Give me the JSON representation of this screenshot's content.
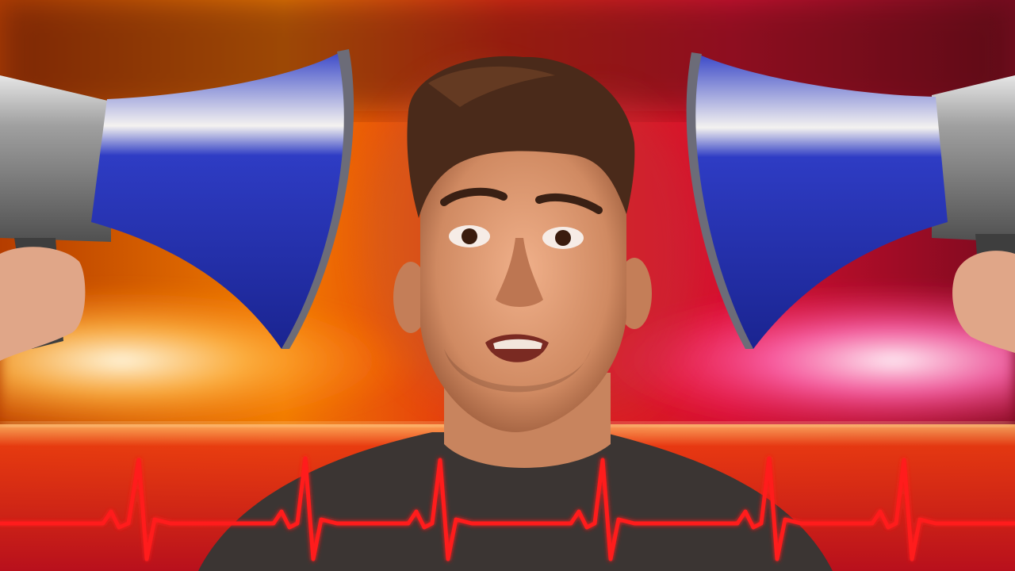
{
  "scene": {
    "subject": "worried-man",
    "props": [
      "megaphone-left",
      "megaphone-right",
      "hand-left",
      "hand-right",
      "heartbeat-line"
    ],
    "colors": {
      "left_glow": "#ff8a00",
      "center_red": "#e3122a",
      "right_glow": "#ff2a6a",
      "megaphone_blue": "#2b3dc8",
      "megaphone_grey": "#8c8c8c",
      "heartbeat": "#ff1a1a",
      "skin": "#d99a76",
      "hair": "#4a2a1a",
      "shirt": "#3b3533"
    }
  }
}
